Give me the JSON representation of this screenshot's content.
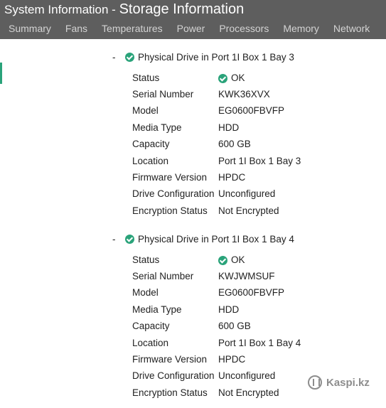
{
  "header": {
    "title_main": "System Information",
    "title_sep": " - ",
    "title_sub": "Storage Information"
  },
  "tabs": [
    {
      "label": "Summary"
    },
    {
      "label": "Fans"
    },
    {
      "label": "Temperatures"
    },
    {
      "label": "Power"
    },
    {
      "label": "Processors"
    },
    {
      "label": "Memory"
    },
    {
      "label": "Network"
    }
  ],
  "drives": [
    {
      "collapse_symbol": "-",
      "status_icon": "ok-check-icon",
      "title": "Physical Drive in Port 1I Box 1 Bay 3",
      "fields": [
        {
          "label": "Status",
          "value": "OK"
        },
        {
          "label": "Serial Number",
          "value": "KWK36XVX"
        },
        {
          "label": "Model",
          "value": "EG0600FBVFP"
        },
        {
          "label": "Media Type",
          "value": "HDD"
        },
        {
          "label": "Capacity",
          "value": "600 GB"
        },
        {
          "label": "Location",
          "value": "Port 1I Box 1 Bay 3"
        },
        {
          "label": "Firmware Version",
          "value": "HPDC"
        },
        {
          "label": "Drive Configuration",
          "value": "Unconfigured"
        },
        {
          "label": "Encryption Status",
          "value": "Not Encrypted"
        }
      ]
    },
    {
      "collapse_symbol": "-",
      "status_icon": "ok-check-icon",
      "title": "Physical Drive in Port 1I Box 1 Bay 4",
      "fields": [
        {
          "label": "Status",
          "value": "OK"
        },
        {
          "label": "Serial Number",
          "value": "KWJWMSUF"
        },
        {
          "label": "Model",
          "value": "EG0600FBVFP"
        },
        {
          "label": "Media Type",
          "value": "HDD"
        },
        {
          "label": "Capacity",
          "value": "600 GB"
        },
        {
          "label": "Location",
          "value": "Port 1I Box 1 Bay 4"
        },
        {
          "label": "Firmware Version",
          "value": "HPDC"
        },
        {
          "label": "Drive Configuration",
          "value": "Unconfigured"
        },
        {
          "label": "Encryption Status",
          "value": "Not Encrypted"
        }
      ]
    }
  ],
  "watermark": {
    "text": "Kaspi.kz"
  },
  "colors": {
    "header_bg": "#5e5e5e",
    "ok_green": "#2aa37a",
    "tab_text": "#d3d3d3"
  }
}
